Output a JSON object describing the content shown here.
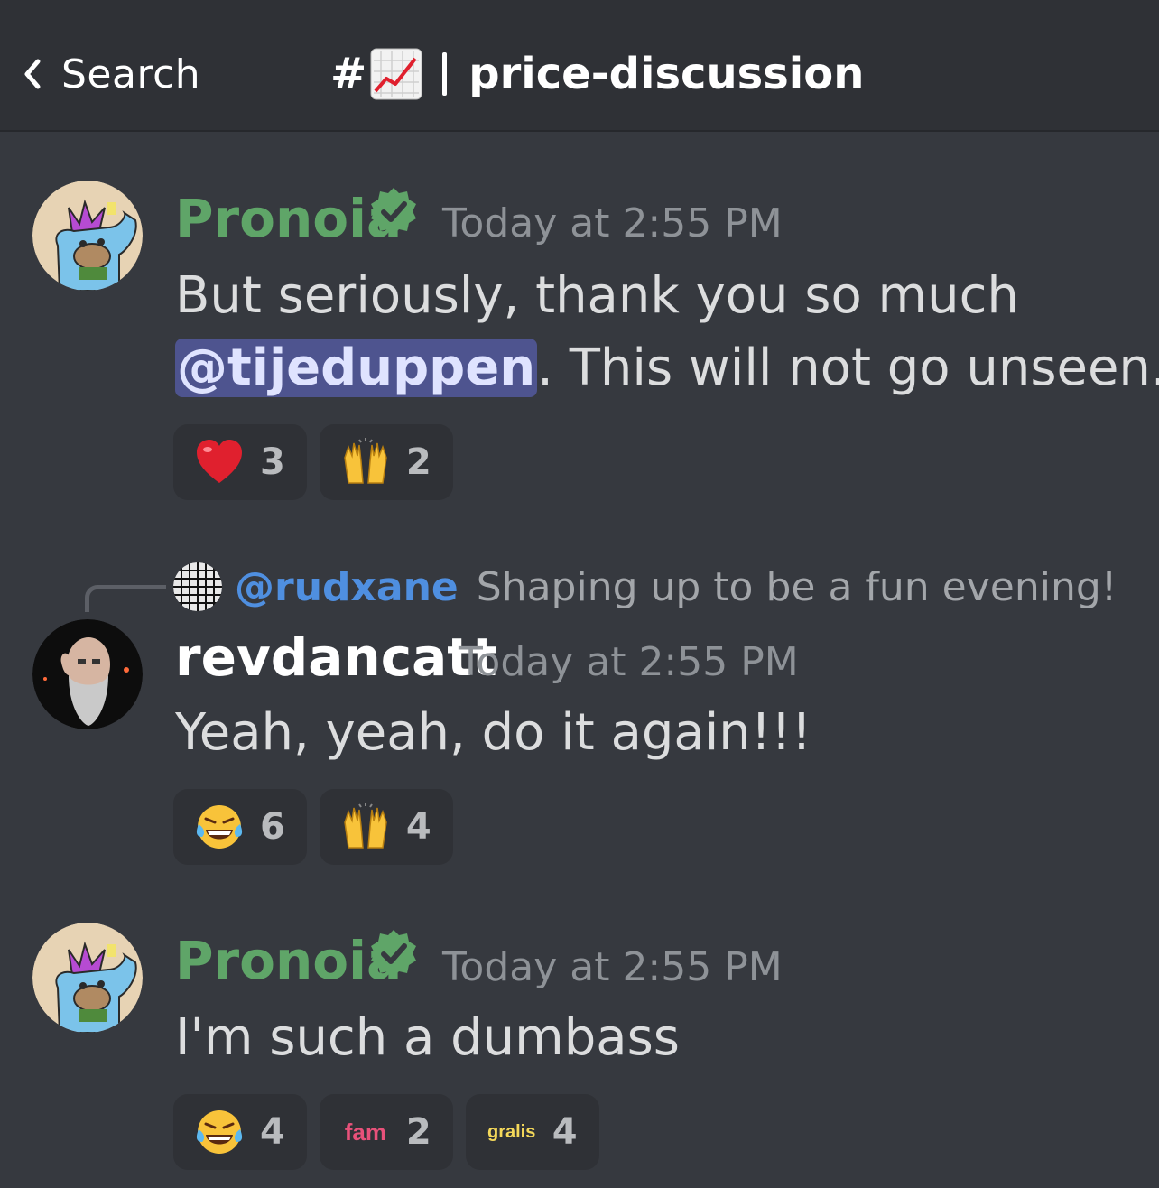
{
  "header": {
    "back_label": "Search",
    "channel_prefix": "#",
    "channel_name": "price-discussion"
  },
  "messages": [
    {
      "author": "Pronoia",
      "author_color": "#5fa568",
      "verified": true,
      "time": "Today at 2:55 PM",
      "text_before": "But seriously, thank you so much",
      "mention": "@tijeduppen",
      "text_after": ". This will not go unseen.",
      "reactions": [
        {
          "icon": "red-heart",
          "count": "3"
        },
        {
          "icon": "raising-hands",
          "count": "2"
        }
      ]
    },
    {
      "reply_to": {
        "author": "@rudxane",
        "text": "Shaping up to be a fun evening!"
      },
      "author": "revdancatt",
      "author_color": "#ffffff",
      "time": "Today at 2:55 PM",
      "text": "Yeah, yeah, do it again!!!",
      "reactions": [
        {
          "icon": "tears-of-joy",
          "count": "6"
        },
        {
          "icon": "raising-hands",
          "count": "4"
        }
      ]
    },
    {
      "author": "Pronoia",
      "author_color": "#5fa568",
      "verified": true,
      "time": "Today at 2:55 PM",
      "text": "I'm such a dumbass",
      "reactions": [
        {
          "icon": "tears-of-joy",
          "count": "4"
        },
        {
          "icon": "fam",
          "label": "fam",
          "count": "2"
        },
        {
          "icon": "gralis",
          "label": "gralis",
          "count": "4"
        }
      ]
    }
  ]
}
